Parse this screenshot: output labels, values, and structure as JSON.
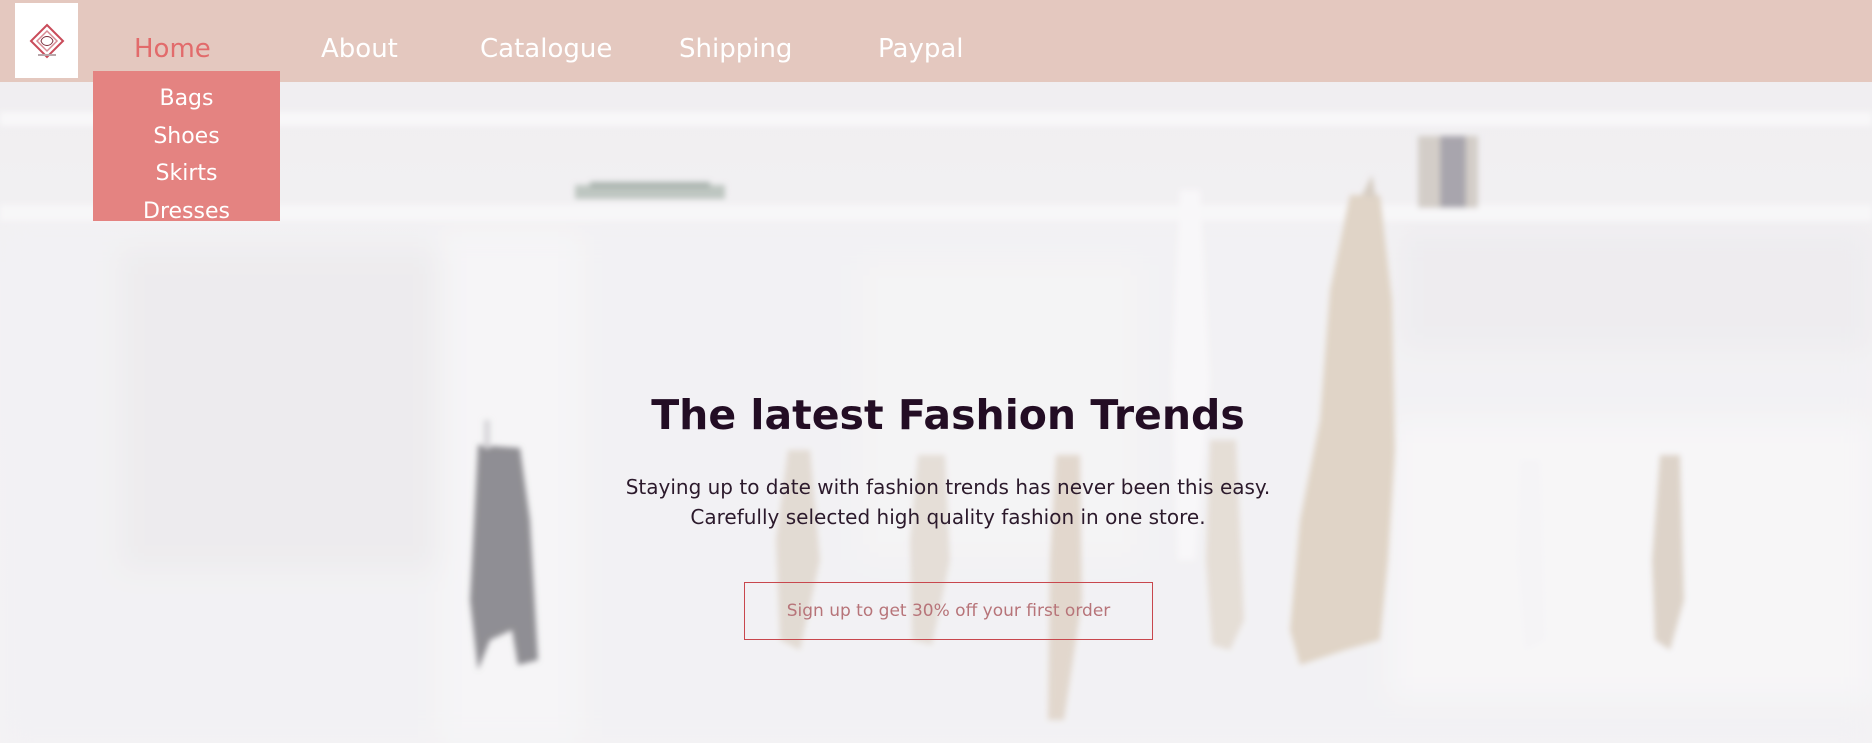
{
  "nav": {
    "items": [
      {
        "label": "Home",
        "active": true
      },
      {
        "label": "About",
        "active": false
      },
      {
        "label": "Catalogue",
        "active": false
      },
      {
        "label": "Shipping",
        "active": false
      },
      {
        "label": "Paypal",
        "active": false
      }
    ],
    "active_color": "#e26b6b",
    "bar_color": "#e4c8bf"
  },
  "dropdown": {
    "items": [
      {
        "label": "Bags"
      },
      {
        "label": "Shoes"
      },
      {
        "label": "Skirts"
      },
      {
        "label": "Dresses"
      }
    ],
    "bg_color": "#e48381"
  },
  "hero": {
    "title": "The latest Fashion Trends",
    "subtitle_line1": "Staying up to date with fashion trends has never been this easy.",
    "subtitle_line2": "Carefully selected high quality fashion in one store.",
    "cta_label": "Sign up to get 30% off your first order"
  },
  "logo": {
    "icon": "diamond-logo-icon"
  }
}
